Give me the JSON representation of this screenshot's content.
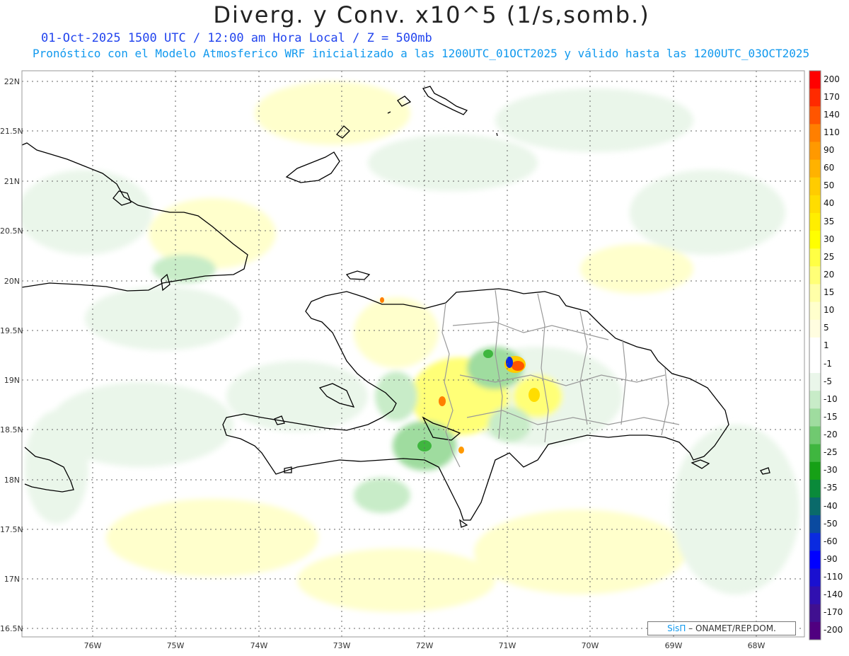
{
  "header": {
    "title": "Diverg. y Conv. x10^5 (1/s,somb.)",
    "subtitle1": "01-Oct-2025  1500 UTC / 12:00 am Hora Local / Z = 500mb",
    "subtitle2": "Pronóstico con el Modelo Atmosferico WRF inicializado a las 1200UTC_01OCT2025 y válido hasta las  1200UTC_03OCT2025"
  },
  "axes": {
    "lat_labels": [
      "22N",
      "21.5N",
      "21N",
      "20.5N",
      "20N",
      "19.5N",
      "19N",
      "18.5N",
      "18N",
      "17.5N",
      "17N",
      "16.5N"
    ],
    "lon_labels": [
      "76W",
      "75W",
      "74W",
      "73W",
      "72W",
      "71W",
      "70W",
      "69W",
      "68W"
    ]
  },
  "colorbar": {
    "labels": [
      "200",
      "170",
      "140",
      "110",
      "90",
      "60",
      "50",
      "40",
      "35",
      "30",
      "25",
      "20",
      "15",
      "10",
      "5",
      "1",
      "-1",
      "-5",
      "-10",
      "-15",
      "-20",
      "-25",
      "-30",
      "-35",
      "-40",
      "-50",
      "-60",
      "-90",
      "-110",
      "-140",
      "-170",
      "-200"
    ],
    "colors": [
      "#ff0000",
      "#ff2a00",
      "#ff5500",
      "#ff7f00",
      "#ff9900",
      "#ffb200",
      "#ffcc00",
      "#ffdd00",
      "#ffee00",
      "#ffff00",
      "#ffff44",
      "#ffff77",
      "#ffffa8",
      "#ffffcc",
      "#fffde0",
      "#ffffff",
      "#ffffff",
      "#eaf6ea",
      "#c8ecc8",
      "#9fdc9f",
      "#70c970",
      "#3fb63f",
      "#16a016",
      "#0a8a3a",
      "#0a6a6a",
      "#0a4aa0",
      "#0a2ae0",
      "#0000ff",
      "#1a10d0",
      "#3010b0",
      "#401090",
      "#500080"
    ]
  },
  "credit": {
    "brand": "SisΠ",
    "text": " – ONAMET/REP.DOM."
  }
}
